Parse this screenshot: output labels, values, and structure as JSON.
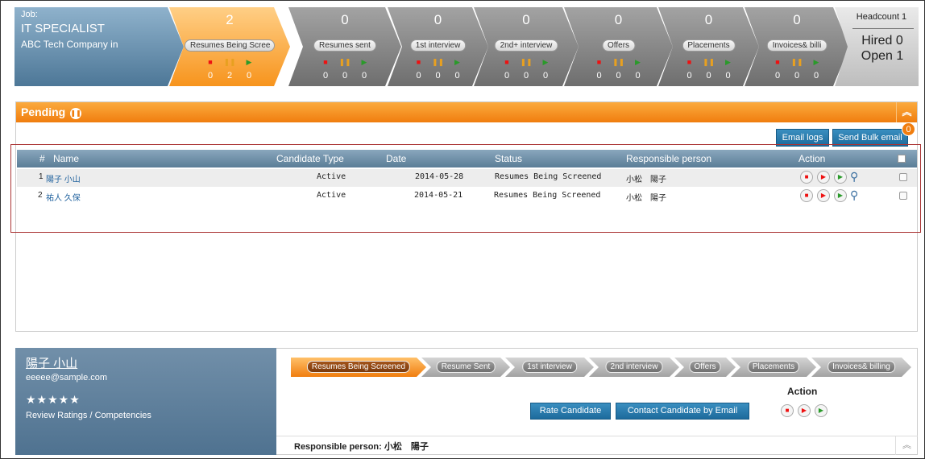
{
  "job": {
    "label": "Job:",
    "title": "IT SPECIALIST",
    "company": "ABC Tech Company in"
  },
  "stages": [
    {
      "count": "2",
      "name": "Resumes Being Scree",
      "stop": "0",
      "pause": "2",
      "play": "0"
    },
    {
      "count": "0",
      "name": "Resumes sent",
      "stop": "0",
      "pause": "0",
      "play": "0"
    },
    {
      "count": "0",
      "name": "1st interview",
      "stop": "0",
      "pause": "0",
      "play": "0"
    },
    {
      "count": "0",
      "name": "2nd+ interview",
      "stop": "0",
      "pause": "0",
      "play": "0"
    },
    {
      "count": "0",
      "name": "Offers",
      "stop": "0",
      "pause": "0",
      "play": "0"
    },
    {
      "count": "0",
      "name": "Placements",
      "stop": "0",
      "pause": "0",
      "play": "0"
    },
    {
      "count": "0",
      "name": "Invoices& billi",
      "stop": "0",
      "pause": "0",
      "play": "0"
    }
  ],
  "headcount": {
    "label": "Headcount 1",
    "hired": "Hired 0",
    "open": "Open 1"
  },
  "pending": {
    "title": "Pending",
    "email_logs": "Email logs",
    "bulk_email": "Send Bulk email",
    "bulk_badge": "0",
    "columns": {
      "num": "#",
      "name": "Name",
      "type": "Candidate Type",
      "date": "Date",
      "status": "Status",
      "resp": "Responsible person",
      "action": "Action"
    },
    "rows": [
      {
        "num": "1",
        "name": "陽子 小山",
        "type": "Active",
        "date": "2014-05-28",
        "status": "Resumes Being Screened",
        "resp": "小松　陽子"
      },
      {
        "num": "2",
        "name": "祐人 久保",
        "type": "Active",
        "date": "2014-05-21",
        "status": "Resumes Being Screened",
        "resp": "小松　陽子"
      }
    ]
  },
  "candidate": {
    "name": "陽子 小山",
    "email": "eeeee@sample.com",
    "stars": "★★★★★",
    "review": "Review Ratings / Competencies",
    "steps": [
      "Resumes Being Screened",
      "Resume Sent",
      "1st interview",
      "2nd interview",
      "Offers",
      "Placements",
      "Invoices& billing"
    ],
    "rate_btn": "Rate Candidate",
    "contact_btn": "Contact Candidate by Email",
    "action_title": "Action",
    "resp_label": "Responsible person: 小松　陽子"
  },
  "icons": {
    "stop": "■",
    "pause": "⏸",
    "play": "▶",
    "collapse": "⌃",
    "search": "🔍"
  }
}
